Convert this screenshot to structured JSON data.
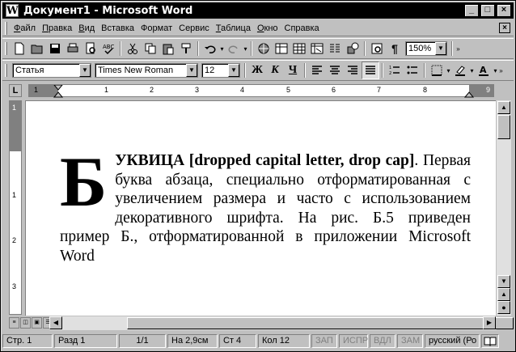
{
  "window": {
    "title": "Документ1 - Microsoft Word",
    "app_icon": "W"
  },
  "menu": [
    {
      "accel": "Ф",
      "rest": "айл"
    },
    {
      "accel": "П",
      "rest": "равка"
    },
    {
      "accel": "В",
      "rest": "ид"
    },
    {
      "accel": "",
      "rest": "Вставка"
    },
    {
      "accel": "",
      "rest": "Формат"
    },
    {
      "accel": "",
      "rest": "Сервис"
    },
    {
      "accel": "Т",
      "rest": "аблица"
    },
    {
      "accel": "О",
      "rest": "кно"
    },
    {
      "accel": "",
      "rest": "Справка"
    }
  ],
  "toolbar1": {
    "zoom": "150%"
  },
  "toolbar2": {
    "style": "Статья",
    "font": "Times New Roman",
    "size": "12",
    "bold": "Ж",
    "italic": "К",
    "underline": "Ч"
  },
  "ruler": {
    "h_numbers": [
      "1",
      "1",
      "2",
      "3",
      "4",
      "5",
      "6",
      "7",
      "8",
      "9"
    ],
    "v_numbers": [
      "1",
      "1",
      "2",
      "3"
    ]
  },
  "document": {
    "drop_cap": "Б",
    "bold_text": "УКВИЦА [dropped capital letter, drop cap]",
    "body_text": ". Первая буква абзаца, специально отформатированная с увеличением размера и часто с использованием декоративного шрифта. На рис. Б.5 приведен пример Б., отформатированной в приложении Microsoft Word"
  },
  "status": {
    "page": "Стр. 1",
    "section": "Разд 1",
    "pages": "1/1",
    "at": "На 2,9см",
    "line": "Ст 4",
    "col": "Кол 12",
    "rec": "ЗАП",
    "trk": "ИСПР",
    "ext": "ВДЛ",
    "ovr": "ЗАМ",
    "language": "русский (Ро"
  }
}
